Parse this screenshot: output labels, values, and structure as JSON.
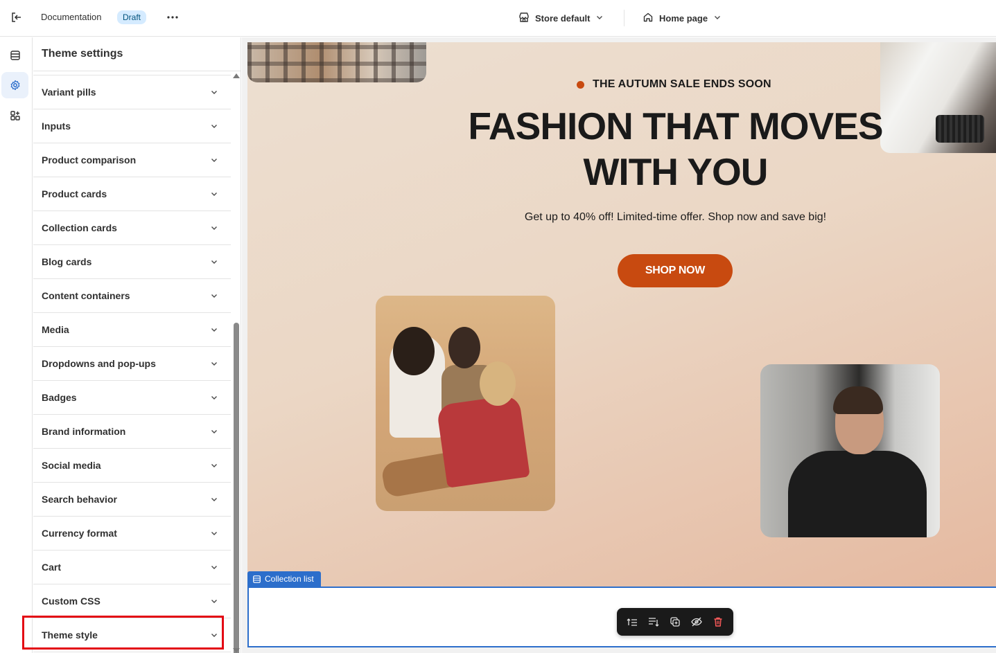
{
  "topbar": {
    "doc_title": "Documentation",
    "status_badge": "Draft",
    "store_select": "Store default",
    "page_select": "Home page"
  },
  "panel": {
    "title": "Theme settings",
    "items": [
      {
        "label": "Variant pills"
      },
      {
        "label": "Inputs"
      },
      {
        "label": "Product comparison"
      },
      {
        "label": "Product cards"
      },
      {
        "label": "Collection cards"
      },
      {
        "label": "Blog cards"
      },
      {
        "label": "Content containers"
      },
      {
        "label": "Media"
      },
      {
        "label": "Dropdowns and pop-ups"
      },
      {
        "label": "Badges"
      },
      {
        "label": "Brand information"
      },
      {
        "label": "Social media"
      },
      {
        "label": "Search behavior"
      },
      {
        "label": "Currency format"
      },
      {
        "label": "Cart"
      },
      {
        "label": "Custom CSS"
      },
      {
        "label": "Theme style"
      }
    ]
  },
  "hero": {
    "sale_text": "THE AUTUMN SALE ENDS SOON",
    "title": "FASHION THAT MOVES WITH YOU",
    "subtitle": "Get up to 40% off! Limited-time offer. Shop now and save big!",
    "cta": "SHOP NOW"
  },
  "section_tag": "Collection list",
  "colors": {
    "accent": "#c84a10",
    "selection": "#2c6ecb",
    "highlight": "#e30613"
  }
}
